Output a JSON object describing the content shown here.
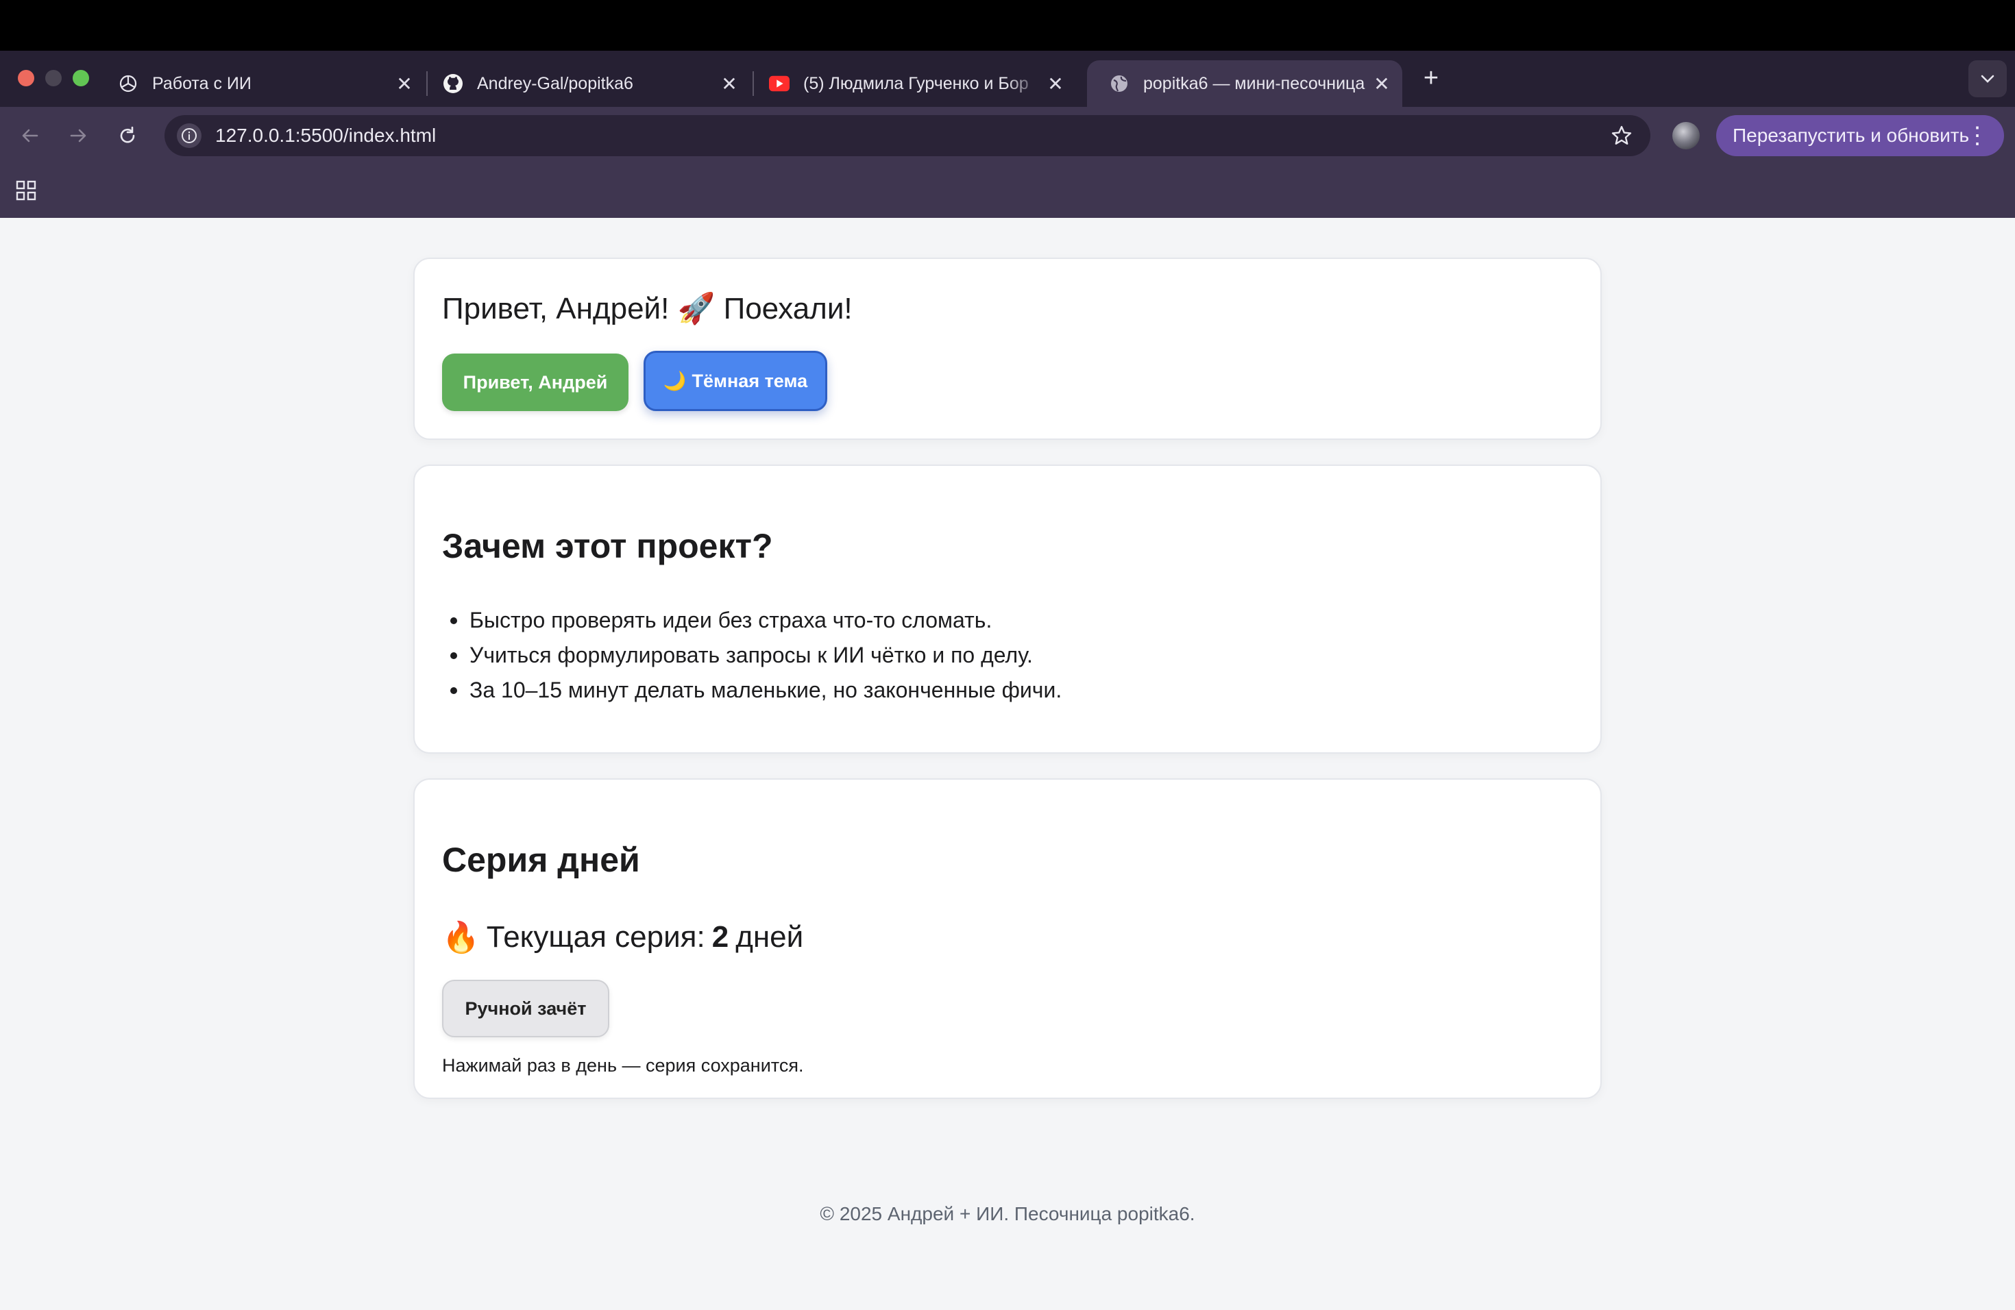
{
  "browser": {
    "tabs": [
      {
        "title": "Работа с ИИ",
        "icon": "openai-icon"
      },
      {
        "title": "Andrey-Gal/popitka6",
        "icon": "github-icon"
      },
      {
        "title": "(5) Людмила Гурченко и Бор",
        "icon": "youtube-icon"
      },
      {
        "title": "popitka6 — мини-песочница",
        "icon": "globe-icon",
        "active": true
      }
    ],
    "url": "127.0.0.1:5500/index.html",
    "relaunch_label": "Перезапустить и обновить"
  },
  "hero": {
    "greeting": "Привет, Андрей! 🚀 Поехали!",
    "greet_button": "Привет, Андрей",
    "theme_button_icon": "🌙",
    "theme_button": "Тёмная тема"
  },
  "about": {
    "title": "Зачем этот проект?",
    "items": [
      "Быстро проверять идеи без страха что-то сломать.",
      "Учиться формулировать запросы к ИИ чётко и по делу.",
      "За 10–15 минут делать маленькие, но законченные фичи."
    ]
  },
  "streak": {
    "title": "Серия дней",
    "fire": "🔥",
    "label": "Текущая серия:",
    "count": "2",
    "unit": "дней",
    "button": "Ручной зачёт",
    "hint": "Нажимай раз в день — серия сохранится."
  },
  "footer": "© 2025 Андрей + ИИ. Песочница popitka6.",
  "colors": {
    "green_button": "#5fae5a",
    "blue_button": "#4b86ef",
    "relaunch": "#6a4fa3",
    "chrome_bg": "#3f3650"
  }
}
